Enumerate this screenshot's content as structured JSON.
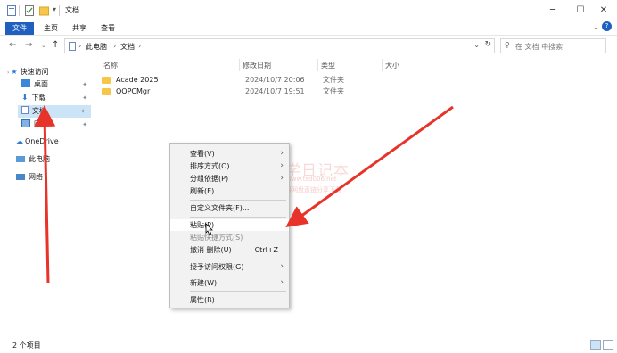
{
  "window": {
    "title": "文档",
    "minimize_glyph": "─",
    "maximize_glyph": "☐",
    "close_glyph": "✕"
  },
  "ribbon": {
    "tabs": [
      "文件",
      "主页",
      "共享",
      "查看"
    ],
    "expand_glyph": "⌄",
    "help_glyph": "?"
  },
  "address": {
    "crumbs": [
      "此电脑",
      "文档"
    ],
    "separator": "›",
    "search_placeholder": "在 文档 中搜索"
  },
  "nav": {
    "items": [
      "快速访问",
      "桌面",
      "下载",
      "文档",
      "图片",
      "OneDrive",
      "此电脑",
      "网络"
    ]
  },
  "columns": {
    "name": "名称",
    "date": "修改日期",
    "type": "类型",
    "size": "大小"
  },
  "files": [
    {
      "name": "Acade 2025",
      "date": "2024/10/7 20:06",
      "type": "文件夹"
    },
    {
      "name": "QQPCMgr",
      "date": "2024/10/7 19:51",
      "type": "文件夹"
    }
  ],
  "context_menu": {
    "view": "查看(V)",
    "sort": "排序方式(O)",
    "group": "分组依据(P)",
    "refresh": "刷新(E)",
    "customize": "自定义文件夹(F)...",
    "paste": "粘贴(P)",
    "paste_shortcut": "粘贴快捷方式(S)",
    "undo": "撤消 删除(U)",
    "undo_shortcut": "Ctrl+Z",
    "grant_access": "授予访问权限(G)",
    "new": "新建(W)",
    "properties": "属性(R)"
  },
  "watermark": {
    "line1": "同学日记本",
    "line2": "www.tsd006.net",
    "line3": "软件、资源、资料网盘直链分享下载"
  },
  "status": {
    "item_count": "2 个项目"
  },
  "colors": {
    "accent": "#1f5fbf",
    "selection": "#cce4f7",
    "annotation_arrow": "#e8332a",
    "folder": "#f5c648"
  }
}
